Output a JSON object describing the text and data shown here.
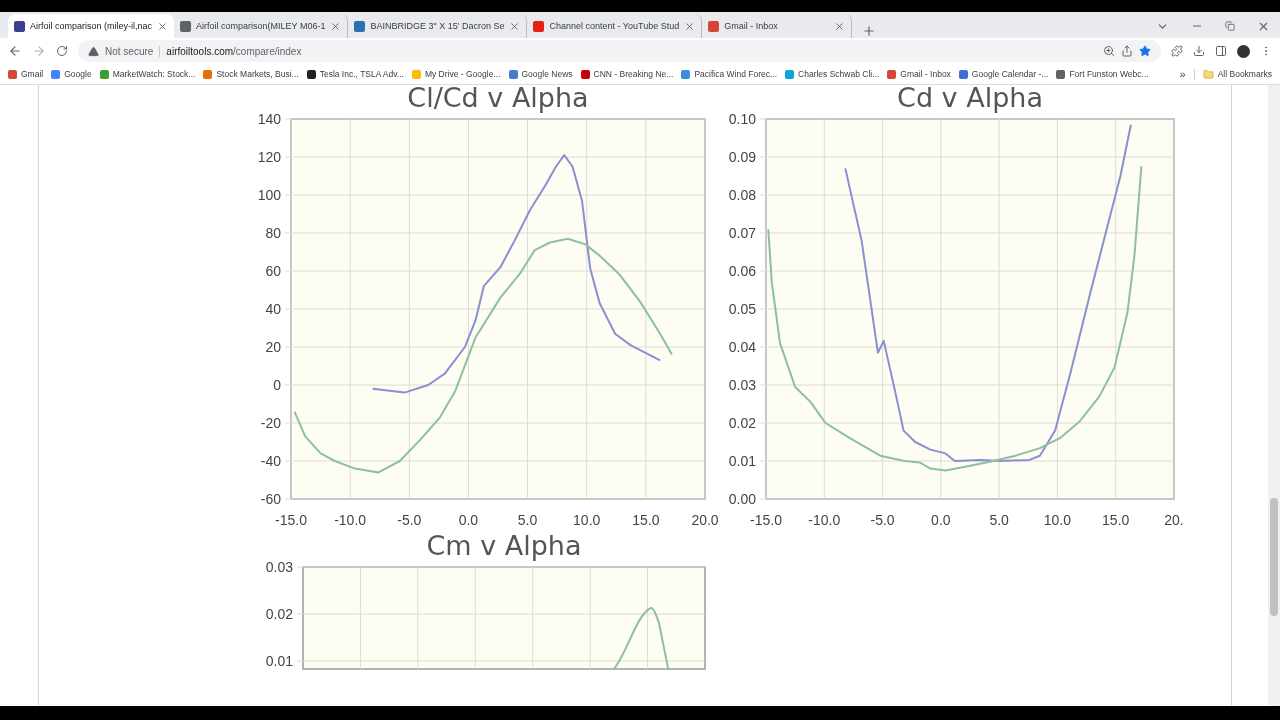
{
  "browser": {
    "tabs": [
      {
        "title": "Airfoil comparison (miley-il,nac",
        "selected": true,
        "color": "#3b3f8f"
      },
      {
        "title": "Airfoil comparison(MILEY M06-1",
        "selected": false,
        "color": "#5f6368"
      },
      {
        "title": "BAINBRIDGE 3\" X 15' Dacron Se",
        "selected": false,
        "color": "#2d6fb5"
      },
      {
        "title": "Channel content - YouTube Stud",
        "selected": false,
        "color": "#e62117"
      },
      {
        "title": "Gmail - Inbox",
        "selected": false,
        "color": "#d44638"
      }
    ],
    "address": {
      "security": "Not secure",
      "host": "airfoiltools.com",
      "path": "/compare/index",
      "bookmarked": true
    },
    "bookmarks": [
      {
        "label": "Gmail",
        "color": "#d44638"
      },
      {
        "label": "Google",
        "color": "#4285f4"
      },
      {
        "label": "MarketWatch: Stock...",
        "color": "#3f9c35"
      },
      {
        "label": "Stock Markets, Busi...",
        "color": "#e46c0a"
      },
      {
        "label": "Tesla Inc., TSLA Adv...",
        "color": "#222222"
      },
      {
        "label": "My Drive - Google...",
        "color": "#fbbc04"
      },
      {
        "label": "Google News",
        "color": "#4a7bd0"
      },
      {
        "label": "CNN - Breaking Ne...",
        "color": "#cc0000"
      },
      {
        "label": "Pacifica Wind Forec...",
        "color": "#3c8dde"
      },
      {
        "label": "Charles Schwab Cli...",
        "color": "#10a4d8"
      },
      {
        "label": "Gmail - Inbox",
        "color": "#d44638"
      },
      {
        "label": "Google Calendar -...",
        "color": "#3a6fd8"
      },
      {
        "label": "Fort Funston Webc...",
        "color": "#5f6368"
      }
    ],
    "bookmarks_overflow": "»",
    "all_bookmarks": "All Bookmarks"
  },
  "charts": [
    {
      "chart_data": {
        "type": "line",
        "title": "Cl/Cd v Alpha",
        "grid": true,
        "xlim": [
          -15,
          20
        ],
        "ylim": [
          -60,
          140
        ],
        "xticks": [
          {
            "value": -15,
            "label": "-15.0"
          },
          {
            "value": -10,
            "label": "-10.0"
          },
          {
            "value": -5,
            "label": "-5.0"
          },
          {
            "value": 0,
            "label": "0.0"
          },
          {
            "value": 5,
            "label": "5.0"
          },
          {
            "value": 10,
            "label": "10.0"
          },
          {
            "value": 15,
            "label": "15.0"
          },
          {
            "value": 20,
            "label": "20.0"
          }
        ],
        "yticks": [
          {
            "value": 140,
            "label": "140"
          },
          {
            "value": 120,
            "label": "120"
          },
          {
            "value": 100,
            "label": "100"
          },
          {
            "value": 80,
            "label": "80"
          },
          {
            "value": 60,
            "label": "60"
          },
          {
            "value": 40,
            "label": "40"
          },
          {
            "value": 20,
            "label": "20"
          },
          {
            "value": 0,
            "label": "0"
          },
          {
            "value": -20,
            "label": "-20"
          },
          {
            "value": -40,
            "label": "-40"
          },
          {
            "value": -60,
            "label": "-60"
          }
        ],
        "series": [
          {
            "color": "#8a8fd2",
            "x": [
              -8.1,
              -5.4,
              -3.4,
              -2,
              -0.3,
              0.6,
              1.3,
              2.7,
              3.9,
              5.2,
              6.5,
              7.4,
              8.1,
              8.8,
              9.6,
              10.3,
              11.1,
              12.4,
              13.7,
              16.2
            ],
            "values": [
              -2,
              -4,
              0,
              6,
              20,
              34,
              52,
              62,
              76,
              92,
              105,
              115,
              121,
              115,
              97,
              61,
              43,
              27,
              21,
              13
            ]
          },
          {
            "color": "#8fbf9c",
            "x": [
              -14.7,
              -13.8,
              -12.5,
              -11.3,
              -9.6,
              -7.6,
              -5.8,
              -4.1,
              -2.4,
              -1.1,
              0.6,
              2.7,
              4.4,
              5.6,
              6.9,
              8.4,
              9.9,
              11.1,
              12.8,
              14.5,
              16.2,
              17.2
            ],
            "values": [
              -14,
              -27,
              -36,
              -40,
              -44,
              -46,
              -40,
              -29,
              -17,
              -3,
              25,
              46,
              59,
              71,
              75,
              77,
              74,
              68,
              58,
              44,
              27,
              16
            ]
          }
        ]
      }
    },
    {
      "chart_data": {
        "type": "line",
        "title": "Cd v Alpha",
        "grid": true,
        "xlim": [
          -15,
          20
        ],
        "ylim": [
          0,
          0.1
        ],
        "xticks": [
          {
            "value": -15,
            "label": "-15.0"
          },
          {
            "value": -10,
            "label": "-10.0"
          },
          {
            "value": -5,
            "label": "-5.0"
          },
          {
            "value": 0,
            "label": "0.0"
          },
          {
            "value": 5,
            "label": "5.0"
          },
          {
            "value": 10,
            "label": "10.0"
          },
          {
            "value": 15,
            "label": "15.0"
          },
          {
            "value": 20,
            "label": "20."
          }
        ],
        "yticks": [
          {
            "value": 0.1,
            "label": "0.10"
          },
          {
            "value": 0.09,
            "label": "0.09"
          },
          {
            "value": 0.08,
            "label": "0.08"
          },
          {
            "value": 0.07,
            "label": "0.07"
          },
          {
            "value": 0.06,
            "label": "0.06"
          },
          {
            "value": 0.05,
            "label": "0.05"
          },
          {
            "value": 0.04,
            "label": "0.04"
          },
          {
            "value": 0.03,
            "label": "0.03"
          },
          {
            "value": 0.02,
            "label": "0.02"
          },
          {
            "value": 0.01,
            "label": "0.01"
          },
          {
            "value": 0,
            "label": "0.00"
          }
        ],
        "series": [
          {
            "color": "#8a8fd2",
            "x": [
              -8.2,
              -6.8,
              -5.4,
              -4.9,
              -3.9,
              -3.2,
              -2.2,
              -0.9,
              0.4,
              1.2,
              3.4,
              5.1,
              7.6,
              8.5,
              9.8,
              11.1,
              12.8,
              14.1,
              15.4,
              16.3
            ],
            "values": [
              0.087,
              0.068,
              0.0385,
              0.0416,
              0.028,
              0.018,
              0.015,
              0.013,
              0.012,
              0.01,
              0.0103,
              0.01,
              0.0103,
              0.0114,
              0.018,
              0.033,
              0.054,
              0.0695,
              0.085,
              0.0985
            ]
          },
          {
            "color": "#8fbf9c",
            "x": [
              -14.8,
              -14.5,
              -13.8,
              -12.5,
              -11.2,
              -9.9,
              -7.8,
              -5.2,
              -3.1,
              -1.8,
              -0.9,
              0.4,
              2.1,
              4.2,
              6.4,
              8.5,
              10.2,
              11.9,
              13.6,
              14.9,
              16,
              16.6,
              17.2
            ],
            "values": [
              0.071,
              0.057,
              0.041,
              0.0295,
              0.0256,
              0.02,
              0.016,
              0.0114,
              0.01,
              0.0096,
              0.008,
              0.0075,
              0.0085,
              0.0098,
              0.0114,
              0.0134,
              0.016,
              0.0204,
              0.027,
              0.0346,
              0.049,
              0.064,
              0.0876
            ]
          }
        ]
      }
    }
  ],
  "cm_chart": {
    "title": "Cm v Alpha",
    "ytick_labels": [
      "0.03",
      "0.02",
      "0.01"
    ]
  }
}
